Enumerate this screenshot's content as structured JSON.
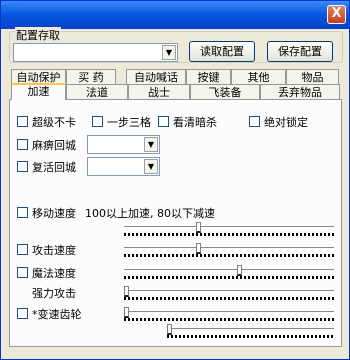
{
  "window": {
    "close_glyph": "X"
  },
  "config": {
    "group_label": "配置存取",
    "selected": "",
    "read_button": "读取配置",
    "save_button": "保存配置"
  },
  "tabs_row1": [
    "自动保护",
    "买 药",
    "自动喊话",
    "按键",
    "其他",
    "物品"
  ],
  "tabs_row2": [
    "加速",
    "法道",
    "战士",
    "飞装备",
    "丢弃物品"
  ],
  "active_tab": "加速",
  "options": {
    "super_no_lag": "超级不卡",
    "one_step_three": "一步三格",
    "see_stealth": "看清暗杀",
    "absolute_lock": "绝对锁定",
    "paralysis_return": "麻痹回城",
    "paralysis_value": "",
    "revive_return": "复活回城",
    "revive_value": ""
  },
  "speed": {
    "move_label": "移动速度",
    "move_hint": "100以上加速, 80以下减速",
    "move_level": 0.35,
    "attack_label": "攻击速度",
    "attack_level": 0.35,
    "magic_label": "魔法速度",
    "magic_level": 0.55,
    "strong_attack_label": "强力攻击",
    "strong_attack_level": 0.0,
    "gear_label": "*变速齿轮",
    "gear_level": 0.0,
    "extra_level": 0.0
  }
}
